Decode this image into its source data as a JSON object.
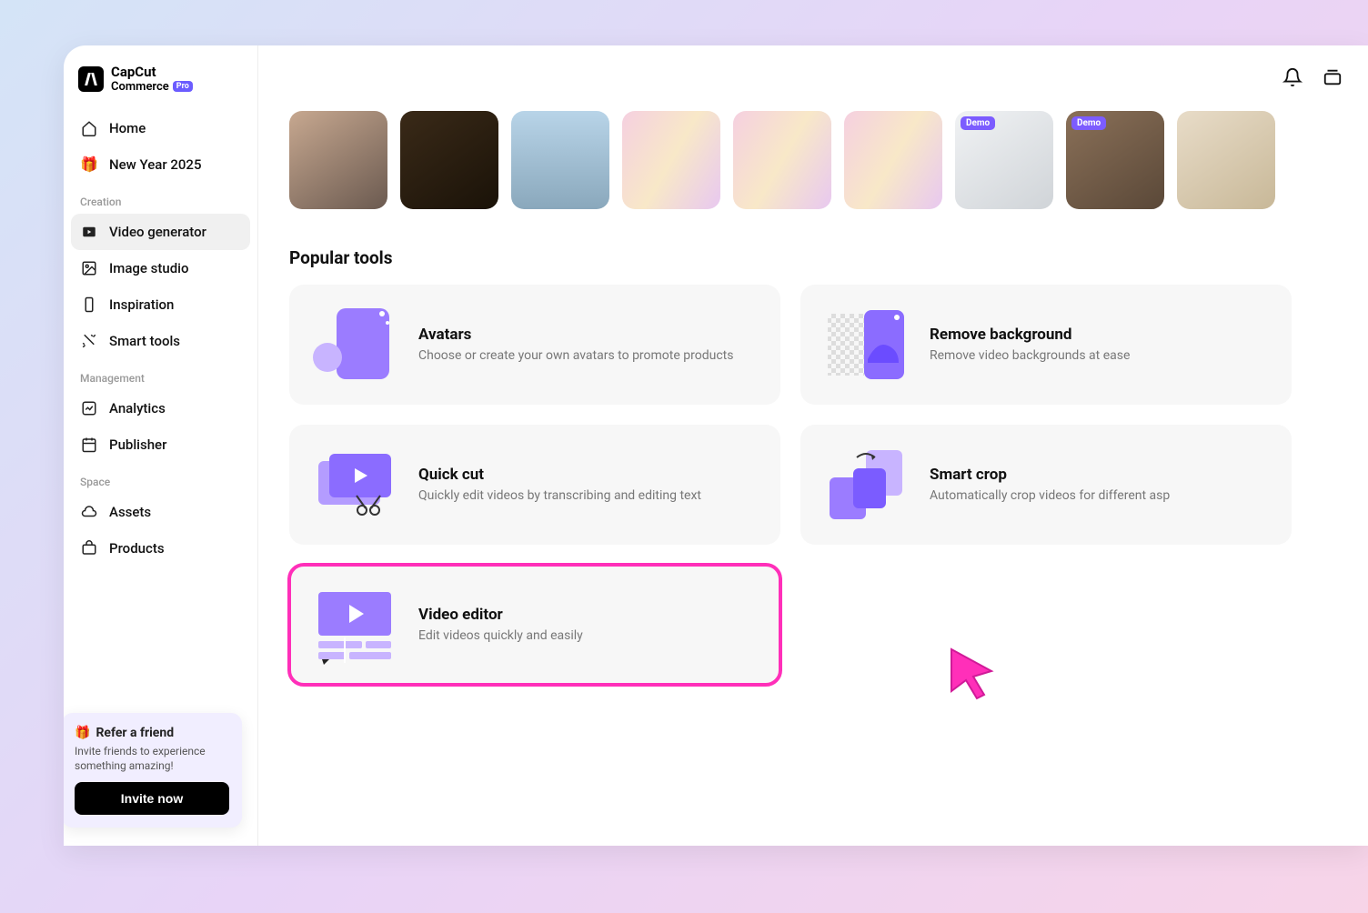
{
  "brand": {
    "line1": "CapCut",
    "line2": "Commerce",
    "badge": "Pro"
  },
  "nav": {
    "home": "Home",
    "new_year": "New Year 2025",
    "creation_label": "Creation",
    "video_generator": "Video generator",
    "image_studio": "Image studio",
    "inspiration": "Inspiration",
    "smart_tools": "Smart tools",
    "management_label": "Management",
    "analytics": "Analytics",
    "publisher": "Publisher",
    "space_label": "Space",
    "assets": "Assets",
    "products": "Products"
  },
  "refer": {
    "title": "Refer a friend",
    "desc": "Invite friends to experience something amazing!",
    "button": "Invite now"
  },
  "thumbnails": {
    "demo_badge": "Demo"
  },
  "popular": {
    "title": "Popular tools",
    "avatars": {
      "title": "Avatars",
      "desc": "Choose or create your own avatars to promote products"
    },
    "remove_bg": {
      "title": "Remove background",
      "desc": "Remove video backgrounds at ease"
    },
    "quick_cut": {
      "title": "Quick cut",
      "desc": "Quickly edit videos by transcribing and editing text"
    },
    "smart_crop": {
      "title": "Smart crop",
      "desc": "Automatically crop videos for different asp"
    },
    "video_editor": {
      "title": "Video editor",
      "desc": "Edit videos quickly and easily"
    }
  }
}
